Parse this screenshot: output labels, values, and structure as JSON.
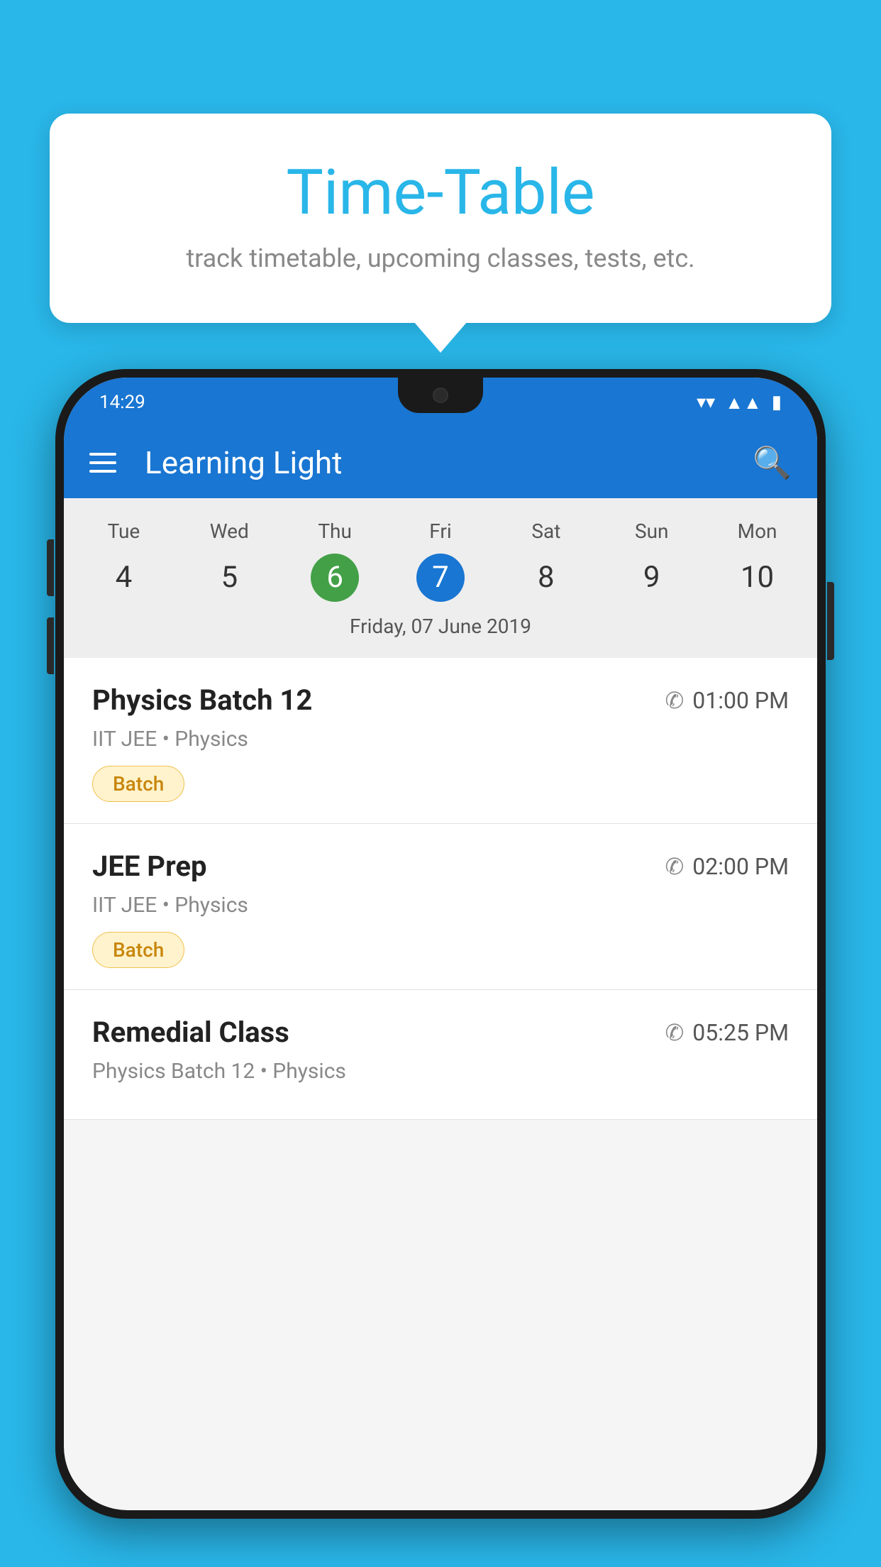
{
  "page": {
    "background_color": "#29b6e8"
  },
  "tooltip": {
    "title": "Time-Table",
    "subtitle": "track timetable, upcoming classes, tests, etc."
  },
  "status_bar": {
    "time": "14:29"
  },
  "app_bar": {
    "title": "Learning Light",
    "menu_icon": "hamburger-icon",
    "search_icon": "search-icon"
  },
  "calendar": {
    "days": [
      "Tue",
      "Wed",
      "Thu",
      "Fri",
      "Sat",
      "Sun",
      "Mon"
    ],
    "dates": [
      "4",
      "5",
      "6",
      "7",
      "8",
      "9",
      "10"
    ],
    "today_index": 2,
    "selected_index": 3,
    "selected_date_label": "Friday, 07 June 2019"
  },
  "schedule": {
    "items": [
      {
        "title": "Physics Batch 12",
        "time": "01:00 PM",
        "subtitle": "IIT JEE • Physics",
        "tag": "Batch"
      },
      {
        "title": "JEE Prep",
        "time": "02:00 PM",
        "subtitle": "IIT JEE • Physics",
        "tag": "Batch"
      },
      {
        "title": "Remedial Class",
        "time": "05:25 PM",
        "subtitle": "Physics Batch 12 • Physics",
        "tag": null
      }
    ]
  }
}
